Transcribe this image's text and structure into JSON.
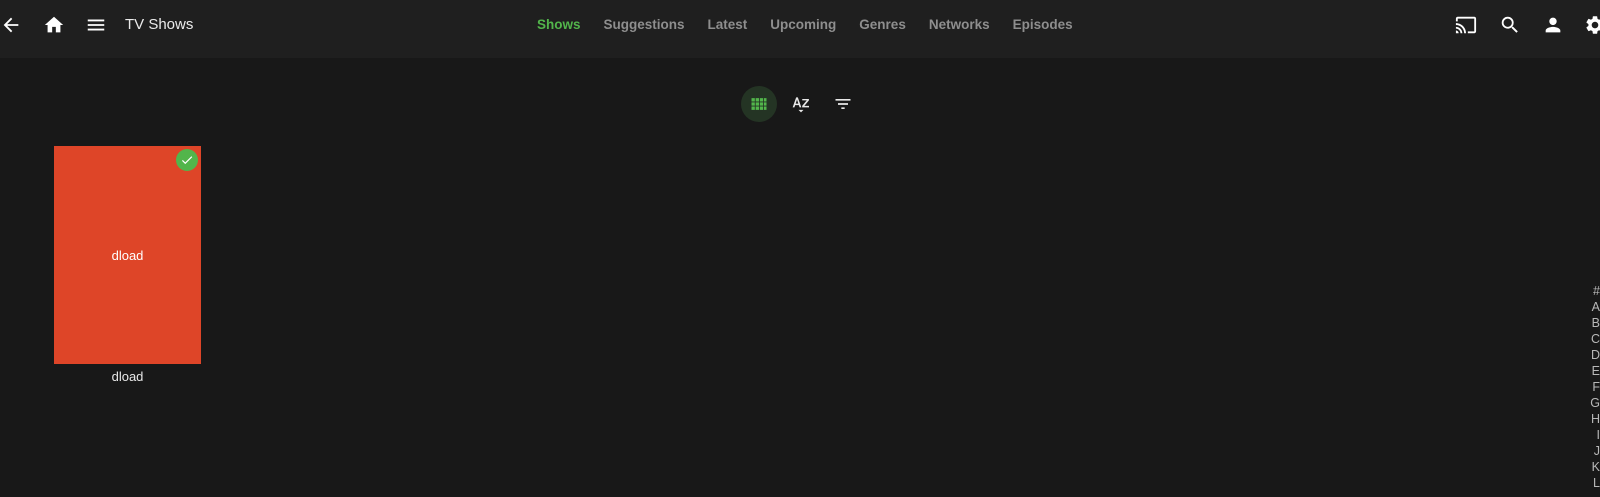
{
  "header": {
    "title": "TV Shows",
    "tabs": [
      {
        "label": "Shows",
        "active": true
      },
      {
        "label": "Suggestions",
        "active": false
      },
      {
        "label": "Latest",
        "active": false
      },
      {
        "label": "Upcoming",
        "active": false
      },
      {
        "label": "Genres",
        "active": false
      },
      {
        "label": "Networks",
        "active": false
      },
      {
        "label": "Episodes",
        "active": false
      }
    ],
    "left_icons": [
      "back-arrow-icon",
      "home-icon",
      "menu-icon"
    ],
    "right_icons": [
      "cast-icon",
      "search-icon",
      "user-icon",
      "settings-icon"
    ]
  },
  "toolbar": {
    "buttons": [
      "grid-view-icon",
      "sort-az-icon",
      "filter-icon"
    ],
    "active_view": "grid-view-icon"
  },
  "items": [
    {
      "poster_text": "dload",
      "title": "dload",
      "played": true,
      "poster_color": "#de4528"
    }
  ],
  "alpha_picker": [
    "#",
    "A",
    "B",
    "C",
    "D",
    "E",
    "F",
    "G",
    "H",
    "I",
    "J",
    "K",
    "L"
  ],
  "colors": {
    "accent": "#52b54b",
    "background": "#181818",
    "header": "#1f1f1f",
    "inactive_tab": "#8e8e8e"
  }
}
